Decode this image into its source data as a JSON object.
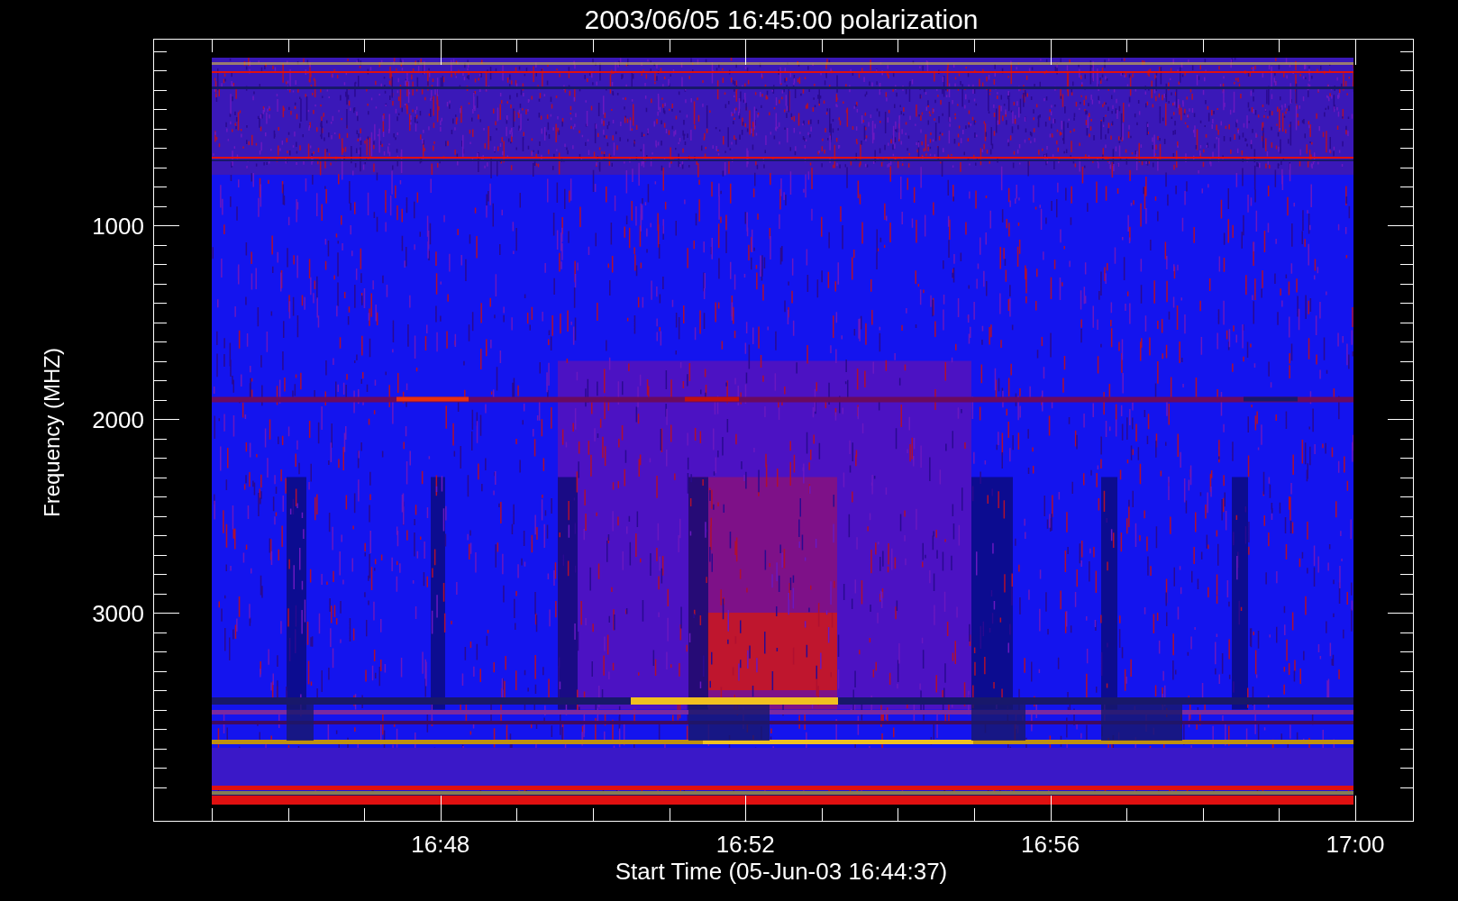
{
  "plot": {
    "title": "2003/06/05 16:45:00 polarization",
    "ylabel": "Frequency (MHZ)",
    "xlabel": "Start Time (05-Jun-03 16:44:37)",
    "ytick_labels": [
      "1000",
      "2000",
      "3000"
    ],
    "xtick_labels": [
      "16:48",
      "16:52",
      "16:56",
      "17:00"
    ]
  }
}
